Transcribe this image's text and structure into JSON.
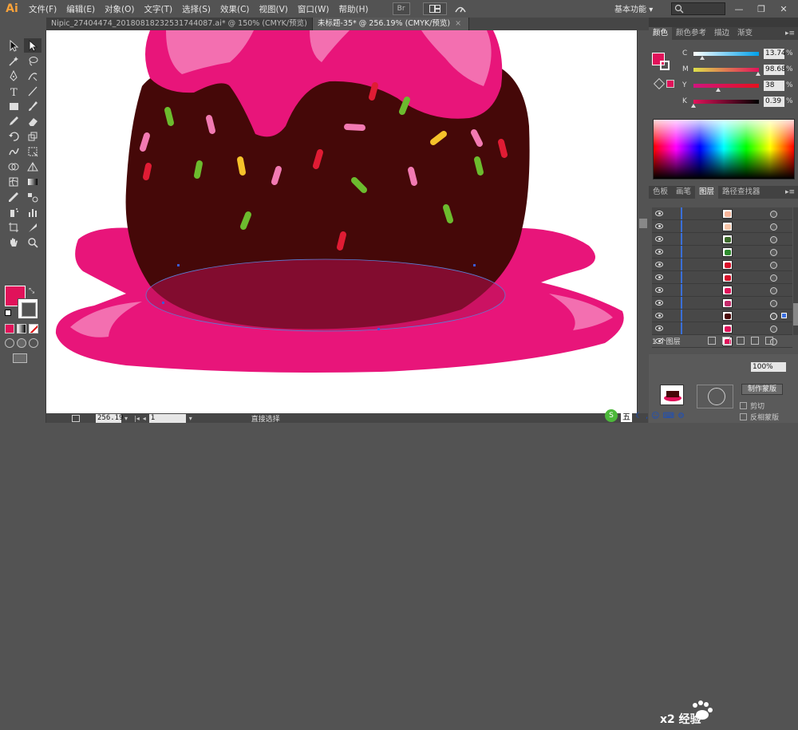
{
  "app": {
    "logo": "Ai"
  },
  "menu": [
    "文件(F)",
    "编辑(E)",
    "对象(O)",
    "文字(T)",
    "选择(S)",
    "效果(C)",
    "视图(V)",
    "窗口(W)",
    "帮助(H)"
  ],
  "menubar_icons": {
    "bridge": "Br",
    "arrange": "arrange-icon",
    "gpu": "gpu-icon"
  },
  "workspace": {
    "label": "基本功能",
    "chevron": "▾"
  },
  "window_buttons": {
    "minimize": "—",
    "restore": "❐",
    "close": "✕"
  },
  "tabs": [
    {
      "label": "Nipic_27404474_20180818232531744087.ai* @ 150% (CMYK/预览)",
      "close": "×",
      "active": false
    },
    {
      "label": "未标题-35* @ 256.19% (CMYK/预览)",
      "close": "×",
      "active": true
    }
  ],
  "tools": [
    "selection-tool",
    "direct-selection-tool",
    "magic-wand-tool",
    "lasso-tool",
    "pen-tool",
    "curvature-tool",
    "type-tool",
    "line-tool",
    "rectangle-tool",
    "paintbrush-tool",
    "pencil-tool",
    "eraser-tool",
    "rotate-tool",
    "scale-tool",
    "warp-tool",
    "free-transform-tool",
    "shape-builder-tool",
    "perspective-tool",
    "mesh-tool",
    "gradient-tool",
    "eyedropper-tool",
    "blend-tool",
    "symbol-sprayer-tool",
    "column-graph-tool",
    "artboard-tool",
    "slice-tool",
    "hand-tool",
    "zoom-tool"
  ],
  "swatches": {
    "fill": "#e1125a",
    "stroke": "#ffffff"
  },
  "status": {
    "zoom": "256.19",
    "page": "1",
    "tool": "直接选择"
  },
  "panels": {
    "color_tabs": [
      "颜色",
      "颜色参考",
      "描边",
      "渐变"
    ],
    "color_tabs_menu": "▸≡",
    "cmyk": [
      {
        "label": "C",
        "value": "13.74",
        "unit": "%",
        "fraction": 0.1374
      },
      {
        "label": "M",
        "value": "98.68",
        "unit": "%",
        "fraction": 0.9868
      },
      {
        "label": "Y",
        "value": "38",
        "unit": "%",
        "fraction": 0.38
      },
      {
        "label": "K",
        "value": "0.39",
        "unit": "%",
        "fraction": 0.0039
      }
    ],
    "layer_tabs": [
      "色板",
      "画笔",
      "图层",
      "路径查找器"
    ],
    "layers_count": "1 个图层",
    "layer_thumbs": [
      "#f7b59a",
      "#f7c5a8",
      "#3d6b2b",
      "#2e8b2e",
      "#d8112a",
      "#d8112a",
      "#e1125a",
      "#c42a6a",
      "#4a0a0a",
      "#e1125a",
      "#e1125a"
    ],
    "opacity": "100%",
    "mask_button": "制作蒙版",
    "clip_label": "剪切",
    "invert_label": "反相蒙版"
  },
  "watermark": {
    "text": "x2 经验"
  },
  "ime": {
    "lang": "五",
    "items": [
      "moon-icon",
      "comma-icon",
      "face-icon",
      "keyboard-icon",
      "settings-icon"
    ]
  },
  "colors": {
    "chrome": "#535353",
    "chocolate": "#450808",
    "glaze": "#e8157a",
    "glaze_light": "#f36fb0",
    "sprinkle_green": "#6cbb2e",
    "sprinkle_red": "#e01c34",
    "sprinkle_pink": "#f27ab2",
    "sprinkle_yellow": "#f6c22a"
  }
}
